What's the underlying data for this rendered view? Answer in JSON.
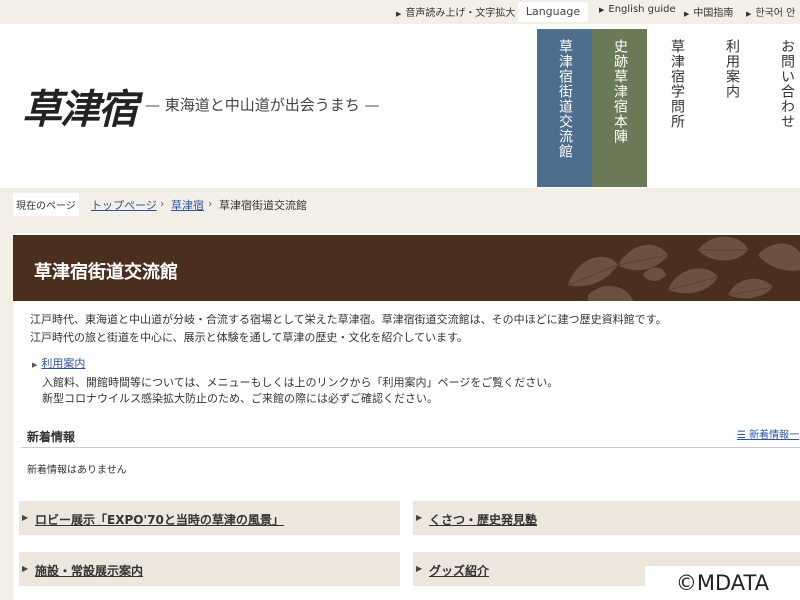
{
  "top_bar": {
    "read_aloud": "音声読み上げ・文字拡大",
    "language_label": "Language",
    "english_guide": "English guide",
    "chinese_guide": "中国指南",
    "korean_guide": "한국어 안"
  },
  "header": {
    "logo_text": "草津宿",
    "tagline": "— 東海道と中山道が出会うまち —",
    "nav": [
      {
        "label": "草津宿街道交流館"
      },
      {
        "label": "史跡草津宿本陣"
      },
      {
        "label": "草津宿学問所"
      },
      {
        "label": "利用案内"
      },
      {
        "label": "お問い合わせ"
      }
    ]
  },
  "breadcrumb": {
    "current_page_label": "現在のページ",
    "items": [
      "トップページ",
      "草津宿",
      "草津宿街道交流館"
    ],
    "separator": "›"
  },
  "page": {
    "title": "草津宿街道交流館",
    "intro_lines": [
      "江戸時代、東海道と中山道が分岐・合流する宿場として栄えた草津宿。草津宿街道交流館は、その中ほどに建つ歴史資料館です。",
      "江戸時代の旅と街道を中心に、展示と体験を通して草津の歴史・文化を紹介しています。"
    ],
    "usage_link": "利用案内",
    "notes": [
      "入館料、開館時間等については、メニューもしくは上のリンクから「利用案内」ページをご覧ください。",
      "新型コロナウイルス感染拡大防止のため、ご来館の際には必ずご確認ください。"
    ]
  },
  "news": {
    "heading": "新着情報",
    "list_link": "新着情報一",
    "empty_message": "新着情報はありません"
  },
  "cards": [
    {
      "label": "ロビー展示「EXPO'70と当時の草津の風景」"
    },
    {
      "label": "くさつ・歴史発見塾"
    },
    {
      "label": "施設・常設展示案内"
    },
    {
      "label": "グッズ紹介"
    }
  ],
  "watermark": "©MDATA",
  "colors": {
    "nav_blue": "#4d6e8c",
    "nav_green": "#6a7a56",
    "title_band": "#4a2e1e",
    "link": "#2b55a0",
    "page_bg": "#f3eee6"
  }
}
